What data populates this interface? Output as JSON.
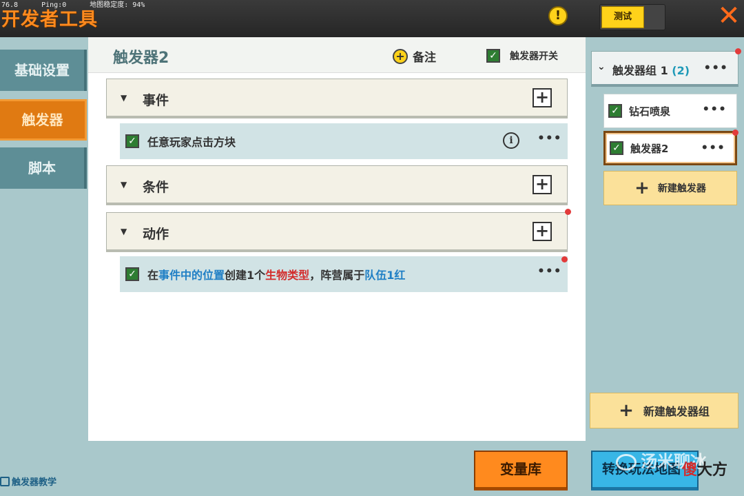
{
  "hud": {
    "fps": "76.8",
    "ping": "Ping:0",
    "stability": "地图稳定度: 94%"
  },
  "app": {
    "title": "开发者工具",
    "test_label": "测试",
    "close_glyph": "✕",
    "alert_glyph": "!"
  },
  "sidebar": {
    "tabs": [
      {
        "label": "基础设置",
        "active": false
      },
      {
        "label": "触发器",
        "active": true
      },
      {
        "label": "脚本",
        "active": false
      }
    ],
    "tutorial_label": "触发器教学"
  },
  "main": {
    "title": "触发器2",
    "note_label": "备注",
    "switch_label": "触发器开关",
    "switch_checked": true,
    "sections": {
      "event": {
        "label": "事件"
      },
      "condition": {
        "label": "条件"
      },
      "action": {
        "label": "动作"
      }
    },
    "event_row": {
      "text": "任意玩家点击方块",
      "checked": true
    },
    "action_row": {
      "parts": [
        {
          "text": "在",
          "style": "normal"
        },
        {
          "text": "事件中的位置",
          "style": "blue"
        },
        {
          "text": "创建1个",
          "style": "normal"
        },
        {
          "text": "生物类型",
          "style": "red"
        },
        {
          "text": "，阵营属于",
          "style": "normal"
        },
        {
          "text": "队伍1红",
          "style": "blue"
        }
      ],
      "checked": true
    },
    "more_glyph": "•••",
    "info_glyph": "i"
  },
  "right_panel": {
    "group": {
      "label": "触发器组 1",
      "count": "(2)"
    },
    "triggers": [
      {
        "label": "钻石喷泉",
        "checked": true,
        "selected": false
      },
      {
        "label": "触发器2",
        "checked": true,
        "selected": true
      }
    ],
    "new_trigger_label": "新建触发器",
    "new_group_label": "新建触发器组"
  },
  "bottom": {
    "variable_library_label": "变量库",
    "convert_label": "转换玩法地图",
    "watermark_text": "汤米聊冰",
    "watermark2_first": "傻",
    "watermark2_rest": "大方"
  },
  "colors": {
    "accent_orange": "#ff8a1e",
    "panel_teal": "#a9c8cb",
    "highlight_blue": "#1f7fc5",
    "highlight_red": "#d32b2b",
    "check_green": "#2e7d32"
  }
}
